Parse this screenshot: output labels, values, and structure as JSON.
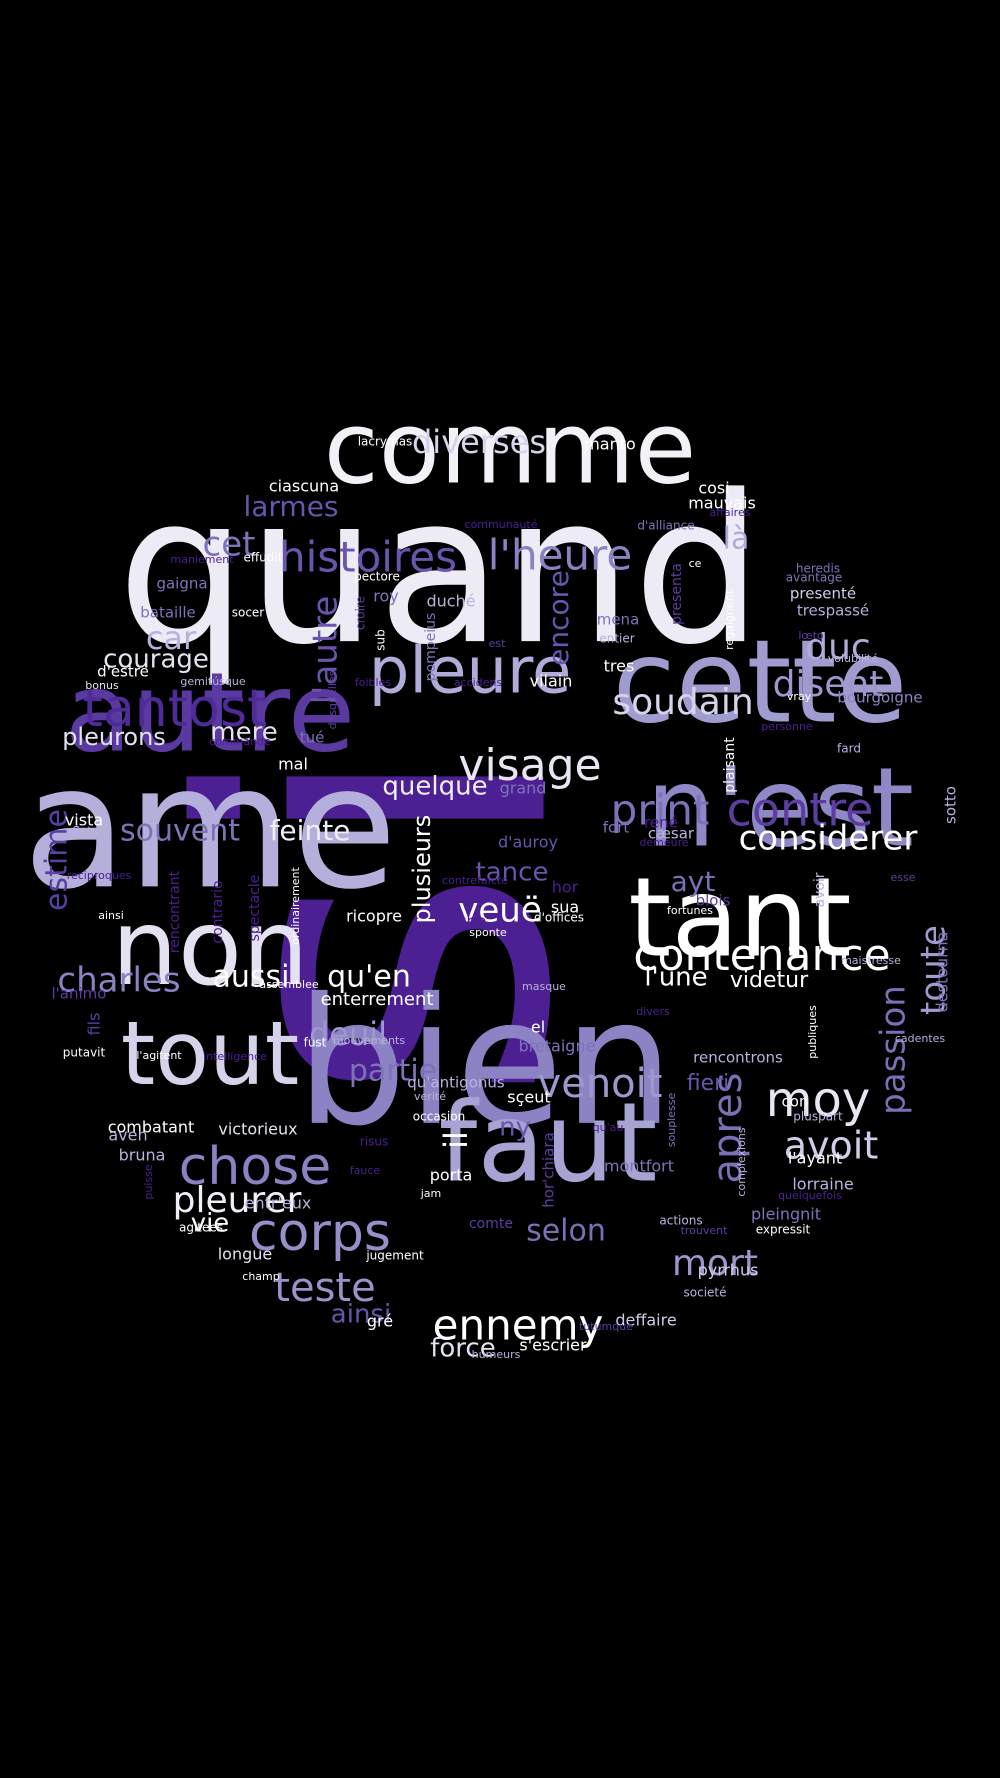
{
  "palette": {
    "background": "#000000",
    "white": "#ffffff",
    "lavender_pale": "#e6e3f3",
    "lavender": "#b7b3dc",
    "periwinkle": "#9c97cc",
    "slate_purple": "#7d74b8",
    "violet": "#5b3ea1",
    "deep_violet": "#4c1f93"
  },
  "words": [
    {
      "text": "si",
      "color": "#4c1f93",
      "icon": "none"
    },
    {
      "text": "quand",
      "color": "#ecebf6"
    },
    {
      "text": "ame",
      "color": "#b4b0db"
    },
    {
      "text": "bien",
      "color": "#8b83c4"
    },
    {
      "text": "cette",
      "color": "#a09ccf"
    },
    {
      "text": "n'est",
      "color": "#8f88c6"
    },
    {
      "text": "comme",
      "color": "#f2f1f8"
    },
    {
      "text": "autre",
      "color": "#5a3aa1"
    },
    {
      "text": "tant",
      "color": "#ffffff"
    },
    {
      "text": "non",
      "color": "#e4e2f1"
    },
    {
      "text": "faut",
      "color": "#a7a3d3"
    },
    {
      "text": "tout",
      "color": "#d5d2ea"
    },
    {
      "text": "pleure",
      "color": "#b0acd9"
    },
    {
      "text": "tantost",
      "color": "#4e2b99"
    },
    {
      "text": "contenance",
      "color": "#ffffff"
    },
    {
      "text": "visage",
      "color": "#e8e6f3"
    },
    {
      "text": "corps",
      "color": "#9590c9"
    },
    {
      "text": "chose",
      "color": "#8a83c3"
    },
    {
      "text": "histoires",
      "color": "#6a54ad"
    },
    {
      "text": "l'heure",
      "color": "#8a83c3"
    },
    {
      "text": "print",
      "color": "#7c72b8"
    },
    {
      "text": "contre",
      "color": "#5c3ea2"
    },
    {
      "text": "soudain",
      "color": "#d6d3ea"
    },
    {
      "text": "considerer",
      "color": "#ffffff"
    },
    {
      "text": "ennemy",
      "color": "#ffffff"
    },
    {
      "text": "teste",
      "color": "#9992cb"
    },
    {
      "text": "pleurer",
      "color": "#f0eff7"
    },
    {
      "text": "venoit",
      "color": "#9c97cc"
    },
    {
      "text": "moy",
      "color": "#e8e6f3"
    },
    {
      "text": "avoit",
      "color": "#d0cde8"
    },
    {
      "text": "mort",
      "color": "#9c97cc"
    },
    {
      "text": "apres",
      "color": "#7a70b6"
    },
    {
      "text": "passion",
      "color": "#7a70b6"
    },
    {
      "text": "toute",
      "color": "#a09ccf"
    },
    {
      "text": "disent",
      "color": "#9c97cc"
    },
    {
      "text": "duc",
      "color": "#b0acd9"
    },
    {
      "text": "diverses",
      "color": "#d6d3ea"
    },
    {
      "text": "larmes",
      "color": "#6a54ad"
    },
    {
      "text": "cet",
      "color": "#7d74b8"
    },
    {
      "text": "car",
      "color": "#b7b3dc"
    },
    {
      "text": "courage",
      "color": "#e4e2f1"
    },
    {
      "text": "pleurons",
      "color": "#e4e2f1"
    },
    {
      "text": "mere",
      "color": "#e4e2f1"
    },
    {
      "text": "l'autre",
      "color": "#6a54ad"
    },
    {
      "text": "encore",
      "color": "#6a54ad"
    },
    {
      "text": "quelque",
      "color": "#f0eff7"
    },
    {
      "text": "souvent",
      "color": "#7d74b8"
    },
    {
      "text": "feinte",
      "color": "#f0eff7"
    },
    {
      "text": "estime",
      "color": "#5b3ea1"
    },
    {
      "text": "charles",
      "color": "#8a83c3"
    },
    {
      "text": "aussi",
      "color": "#ffffff"
    },
    {
      "text": "qu'en",
      "color": "#ffffff"
    },
    {
      "text": "deuil",
      "color": "#9c97cc"
    },
    {
      "text": "partie",
      "color": "#7d74b8"
    },
    {
      "text": "veuë",
      "color": "#ffffff"
    },
    {
      "text": "tance",
      "color": "#6a54ad"
    },
    {
      "text": "ayt",
      "color": "#7a70b6"
    },
    {
      "text": "l'une",
      "color": "#ffffff"
    },
    {
      "text": "videtur",
      "color": "#ffffff"
    },
    {
      "text": "selon",
      "color": "#7a70b6"
    },
    {
      "text": "ainsi",
      "color": "#6a54ad"
    },
    {
      "text": "force",
      "color": "#e4e2f1"
    },
    {
      "text": "il",
      "color": "#ffffff"
    },
    {
      "text": "plusieurs",
      "color": "#ffffff"
    },
    {
      "text": "là",
      "color": "#b0acd9"
    },
    {
      "text": "vie",
      "color": "#ffffff"
    },
    {
      "text": "ny",
      "color": "#6a54ad"
    },
    {
      "text": "enterrement",
      "color": "#ffffff"
    },
    {
      "text": "fieri",
      "color": "#6a54ad"
    },
    {
      "text": "deffaire",
      "color": "#d0cde8"
    },
    {
      "text": "lacrymas",
      "color": "#ffffff"
    },
    {
      "text": "manto",
      "color": "#ffffff"
    },
    {
      "text": "ciascuna",
      "color": "#ffffff"
    },
    {
      "text": "cosi",
      "color": "#ffffff"
    },
    {
      "text": "mauvais",
      "color": "#ffffff"
    },
    {
      "text": "communauté",
      "color": "#4c1f93"
    },
    {
      "text": "affaires",
      "color": "#4c1f93"
    },
    {
      "text": "d'alliance",
      "color": "#7d74b8"
    },
    {
      "text": "maniement",
      "color": "#4c1f93"
    },
    {
      "text": "effudit",
      "color": "#ffffff"
    },
    {
      "text": "pectore",
      "color": "#ffffff"
    },
    {
      "text": "roy",
      "color": "#7d74b8"
    },
    {
      "text": "duché",
      "color": "#b7b3dc"
    },
    {
      "text": "gaigna",
      "color": "#7d74b8"
    },
    {
      "text": "bataille",
      "color": "#7d74b8"
    },
    {
      "text": "socer",
      "color": "#ffffff"
    },
    {
      "text": "croire",
      "color": "#5b3ea1"
    },
    {
      "text": "sub",
      "color": "#ffffff"
    },
    {
      "text": "pompeius",
      "color": "#7d74b8"
    },
    {
      "text": "mena",
      "color": "#7d74b8"
    },
    {
      "text": "presenta",
      "color": "#5b3ea1"
    },
    {
      "text": "regaignent",
      "color": "#ffffff"
    },
    {
      "text": "ce",
      "color": "#ffffff"
    },
    {
      "text": "heredis",
      "color": "#7d74b8"
    },
    {
      "text": "avantage",
      "color": "#7d74b8"
    },
    {
      "text": "presenté",
      "color": "#d0cde8"
    },
    {
      "text": "trespassé",
      "color": "#b0acd9"
    },
    {
      "text": "est",
      "color": "#5b3ea1"
    },
    {
      "text": "entier",
      "color": "#b7b3dc"
    },
    {
      "text": "tres",
      "color": "#ffffff"
    },
    {
      "text": "lœto",
      "color": "#5b3ea1"
    },
    {
      "text": "volubilité",
      "color": "#b7b3dc"
    },
    {
      "text": "d'estre",
      "color": "#ffffff"
    },
    {
      "text": "bonus",
      "color": "#e4e2f1"
    },
    {
      "text": "gemitúsque",
      "color": "#b7b3dc"
    },
    {
      "text": "desquelles",
      "color": "#5b3ea1"
    },
    {
      "text": "foibles",
      "color": "#4c1f93"
    },
    {
      "text": "accidens",
      "color": "#4c1f93"
    },
    {
      "text": "vilain",
      "color": "#ffffff"
    },
    {
      "text": "vray",
      "color": "#ffffff"
    },
    {
      "text": "bourgoigne",
      "color": "#8a83c3"
    },
    {
      "text": "commande",
      "color": "#4c1f93"
    },
    {
      "text": "tué",
      "color": "#7d74b8"
    },
    {
      "text": "personne",
      "color": "#4c1f93"
    },
    {
      "text": "fard",
      "color": "#b7b3dc"
    },
    {
      "text": "grand",
      "color": "#7d74b8"
    },
    {
      "text": "plaisant",
      "color": "#ffffff"
    },
    {
      "text": "mal",
      "color": "#ffffff"
    },
    {
      "text": "vista",
      "color": "#ffffff"
    },
    {
      "text": "fletus",
      "color": "#b7b3dc"
    },
    {
      "text": "sotto",
      "color": "#b7b3dc"
    },
    {
      "text": "fort",
      "color": "#7d74b8"
    },
    {
      "text": "rené",
      "color": "#4c1f93"
    },
    {
      "text": "cæsar",
      "color": "#b7b3dc"
    },
    {
      "text": "demeure",
      "color": "#4c1f93"
    },
    {
      "text": "d'auroy",
      "color": "#6a54ad"
    },
    {
      "text": "reciproques",
      "color": "#4c1f93"
    },
    {
      "text": "rencontrant",
      "color": "#4c1f93"
    },
    {
      "text": "contrario",
      "color": "#4c1f93"
    },
    {
      "text": "spectacle",
      "color": "#4c1f93"
    },
    {
      "text": "ordinairement",
      "color": "#ffffff"
    },
    {
      "text": "ricopre",
      "color": "#ffffff"
    },
    {
      "text": "contrefaicte",
      "color": "#4c1f93"
    },
    {
      "text": "hor",
      "color": "#4c1f93"
    },
    {
      "text": "avoir",
      "color": "#b7b3dc"
    },
    {
      "text": "esse",
      "color": "#5b3ea1"
    },
    {
      "text": "blois",
      "color": "#5b3ea1"
    },
    {
      "text": "sua",
      "color": "#ffffff"
    },
    {
      "text": "d'offices",
      "color": "#ffffff"
    },
    {
      "text": "fortunes",
      "color": "#ffffff"
    },
    {
      "text": "ainsi",
      "color": "#ffffff"
    },
    {
      "text": "che",
      "color": "#4c1f93"
    },
    {
      "text": "sponte",
      "color": "#ffffff"
    },
    {
      "text": "maistresse",
      "color": "#b7b3dc"
    },
    {
      "text": "destourna",
      "color": "#7d74b8"
    },
    {
      "text": "l'animo",
      "color": "#5b3ea1"
    },
    {
      "text": "assemblee",
      "color": "#ffffff"
    },
    {
      "text": "masque",
      "color": "#b7b3dc"
    },
    {
      "text": "celle",
      "color": "#4c1f93"
    },
    {
      "text": "divers",
      "color": "#4c1f93"
    },
    {
      "text": "fils",
      "color": "#5b3ea1"
    },
    {
      "text": "el",
      "color": "#ffffff"
    },
    {
      "text": "publiques",
      "color": "#ffffff"
    },
    {
      "text": "cadentes",
      "color": "#b7b3dc"
    },
    {
      "text": "putavit",
      "color": "#ffffff"
    },
    {
      "text": "fust",
      "color": "#ffffff"
    },
    {
      "text": "mouvements",
      "color": "#b7b3dc"
    },
    {
      "text": "bretaigne",
      "color": "#7d74b8"
    },
    {
      "text": "l'agitent",
      "color": "#ffffff"
    },
    {
      "text": "intelligence",
      "color": "#4c1f93"
    },
    {
      "text": "rencontrons",
      "color": "#b7b3dc"
    },
    {
      "text": "qu'antigonus",
      "color": "#b7b3dc"
    },
    {
      "text": "verité",
      "color": "#b7b3dc"
    },
    {
      "text": "sçeut",
      "color": "#ffffff"
    },
    {
      "text": "con",
      "color": "#ffffff"
    },
    {
      "text": "souplesse",
      "color": "#7d74b8"
    },
    {
      "text": "pluspart",
      "color": "#b7b3dc"
    },
    {
      "text": "combatant",
      "color": "#ffffff"
    },
    {
      "text": "victorieux",
      "color": "#e4e2f1"
    },
    {
      "text": "occasion",
      "color": "#ffffff"
    },
    {
      "text": "hor'chiara",
      "color": "#5b3ea1"
    },
    {
      "text": "qu'au",
      "color": "#4c1f93"
    },
    {
      "text": "l'ayant",
      "color": "#ffffff"
    },
    {
      "text": "aven",
      "color": "#b7b3dc"
    },
    {
      "text": "bruna",
      "color": "#b7b3dc"
    },
    {
      "text": "risus",
      "color": "#4c1f93"
    },
    {
      "text": "montfort",
      "color": "#7d74b8"
    },
    {
      "text": "complexions",
      "color": "#b7b3dc"
    },
    {
      "text": "lorraine",
      "color": "#b7b3dc"
    },
    {
      "text": "puisse",
      "color": "#4c1f93"
    },
    {
      "text": "fauce",
      "color": "#4c1f93"
    },
    {
      "text": "porta",
      "color": "#ffffff"
    },
    {
      "text": "quelquefois",
      "color": "#4c1f93"
    },
    {
      "text": "entr'eux",
      "color": "#b7b3dc"
    },
    {
      "text": "jam",
      "color": "#ffffff"
    },
    {
      "text": "pleingnit",
      "color": "#7d74b8"
    },
    {
      "text": "agitees",
      "color": "#ffffff"
    },
    {
      "text": "comte",
      "color": "#5b3ea1"
    },
    {
      "text": "actions",
      "color": "#b7b3dc"
    },
    {
      "text": "trouvent",
      "color": "#5b3ea1"
    },
    {
      "text": "expressit",
      "color": "#ffffff"
    },
    {
      "text": "longue",
      "color": "#e4e2f1"
    },
    {
      "text": "jugement",
      "color": "#ffffff"
    },
    {
      "text": "pyrrhus",
      "color": "#d0cde8"
    },
    {
      "text": "champ",
      "color": "#ffffff"
    },
    {
      "text": "societé",
      "color": "#b7b3dc"
    },
    {
      "text": "gré",
      "color": "#ffffff"
    },
    {
      "text": "tutumque",
      "color": "#5b3ea1"
    },
    {
      "text": "s'escrier",
      "color": "#ffffff"
    },
    {
      "text": "humeurs",
      "color": "#b7b3dc"
    }
  ]
}
